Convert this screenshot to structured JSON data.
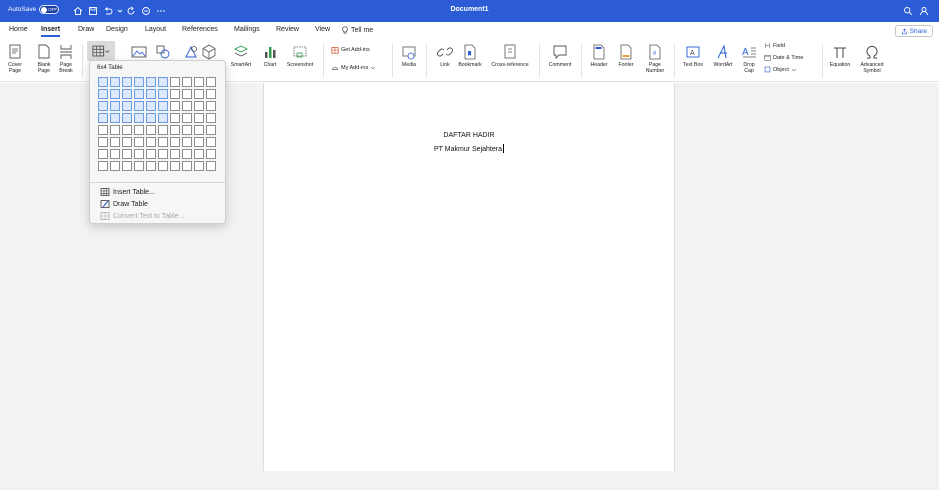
{
  "titlebar": {
    "autosave_label": "AutoSave",
    "autosave_state": "OFF",
    "document_title": "Document1"
  },
  "tabs": [
    "Home",
    "Insert",
    "Draw",
    "Design",
    "Layout",
    "References",
    "Mailings",
    "Review",
    "View",
    "Tell me"
  ],
  "active_tab": "Insert",
  "share_label": "Share",
  "ribbon": {
    "cover_page": "Cover\nPage",
    "blank_page": "Blank\nPage",
    "page_break": "Page\nBreak",
    "smartart": "SmartArt",
    "chart": "Chart",
    "screenshot": "Screenshot",
    "get_addins": "Get Add-ins",
    "my_addins": "My Add-ins",
    "media": "Media",
    "link": "Link",
    "bookmark": "Bookmark",
    "cross_reference": "Cross-reference",
    "comment": "Comment",
    "header": "Header",
    "footer": "Footer",
    "page_number": "Page\nNumber",
    "text_box": "Text Box",
    "wordart": "WordArt",
    "drop_cap": "Drop\nCap",
    "field": "Field",
    "date_time": "Date & Time",
    "object": "Object",
    "equation": "Equation",
    "advanced_symbol": "Advanced\nSymbol"
  },
  "table_dropdown": {
    "grid_label": "6x4 Table",
    "selected_cols": 6,
    "selected_rows": 4,
    "total_cols": 10,
    "total_rows": 8,
    "insert_table": "Insert Table...",
    "draw_table": "Draw Table",
    "convert_text": "Convert Text to Table..."
  },
  "document": {
    "line1": "DAFTAR HADIR",
    "line2": "PT Makmur Sejahtera"
  },
  "colors": {
    "titlebar": "#2b5cd6",
    "canvas": "#f2f2f2",
    "grid_selected": "#dde9fb"
  }
}
